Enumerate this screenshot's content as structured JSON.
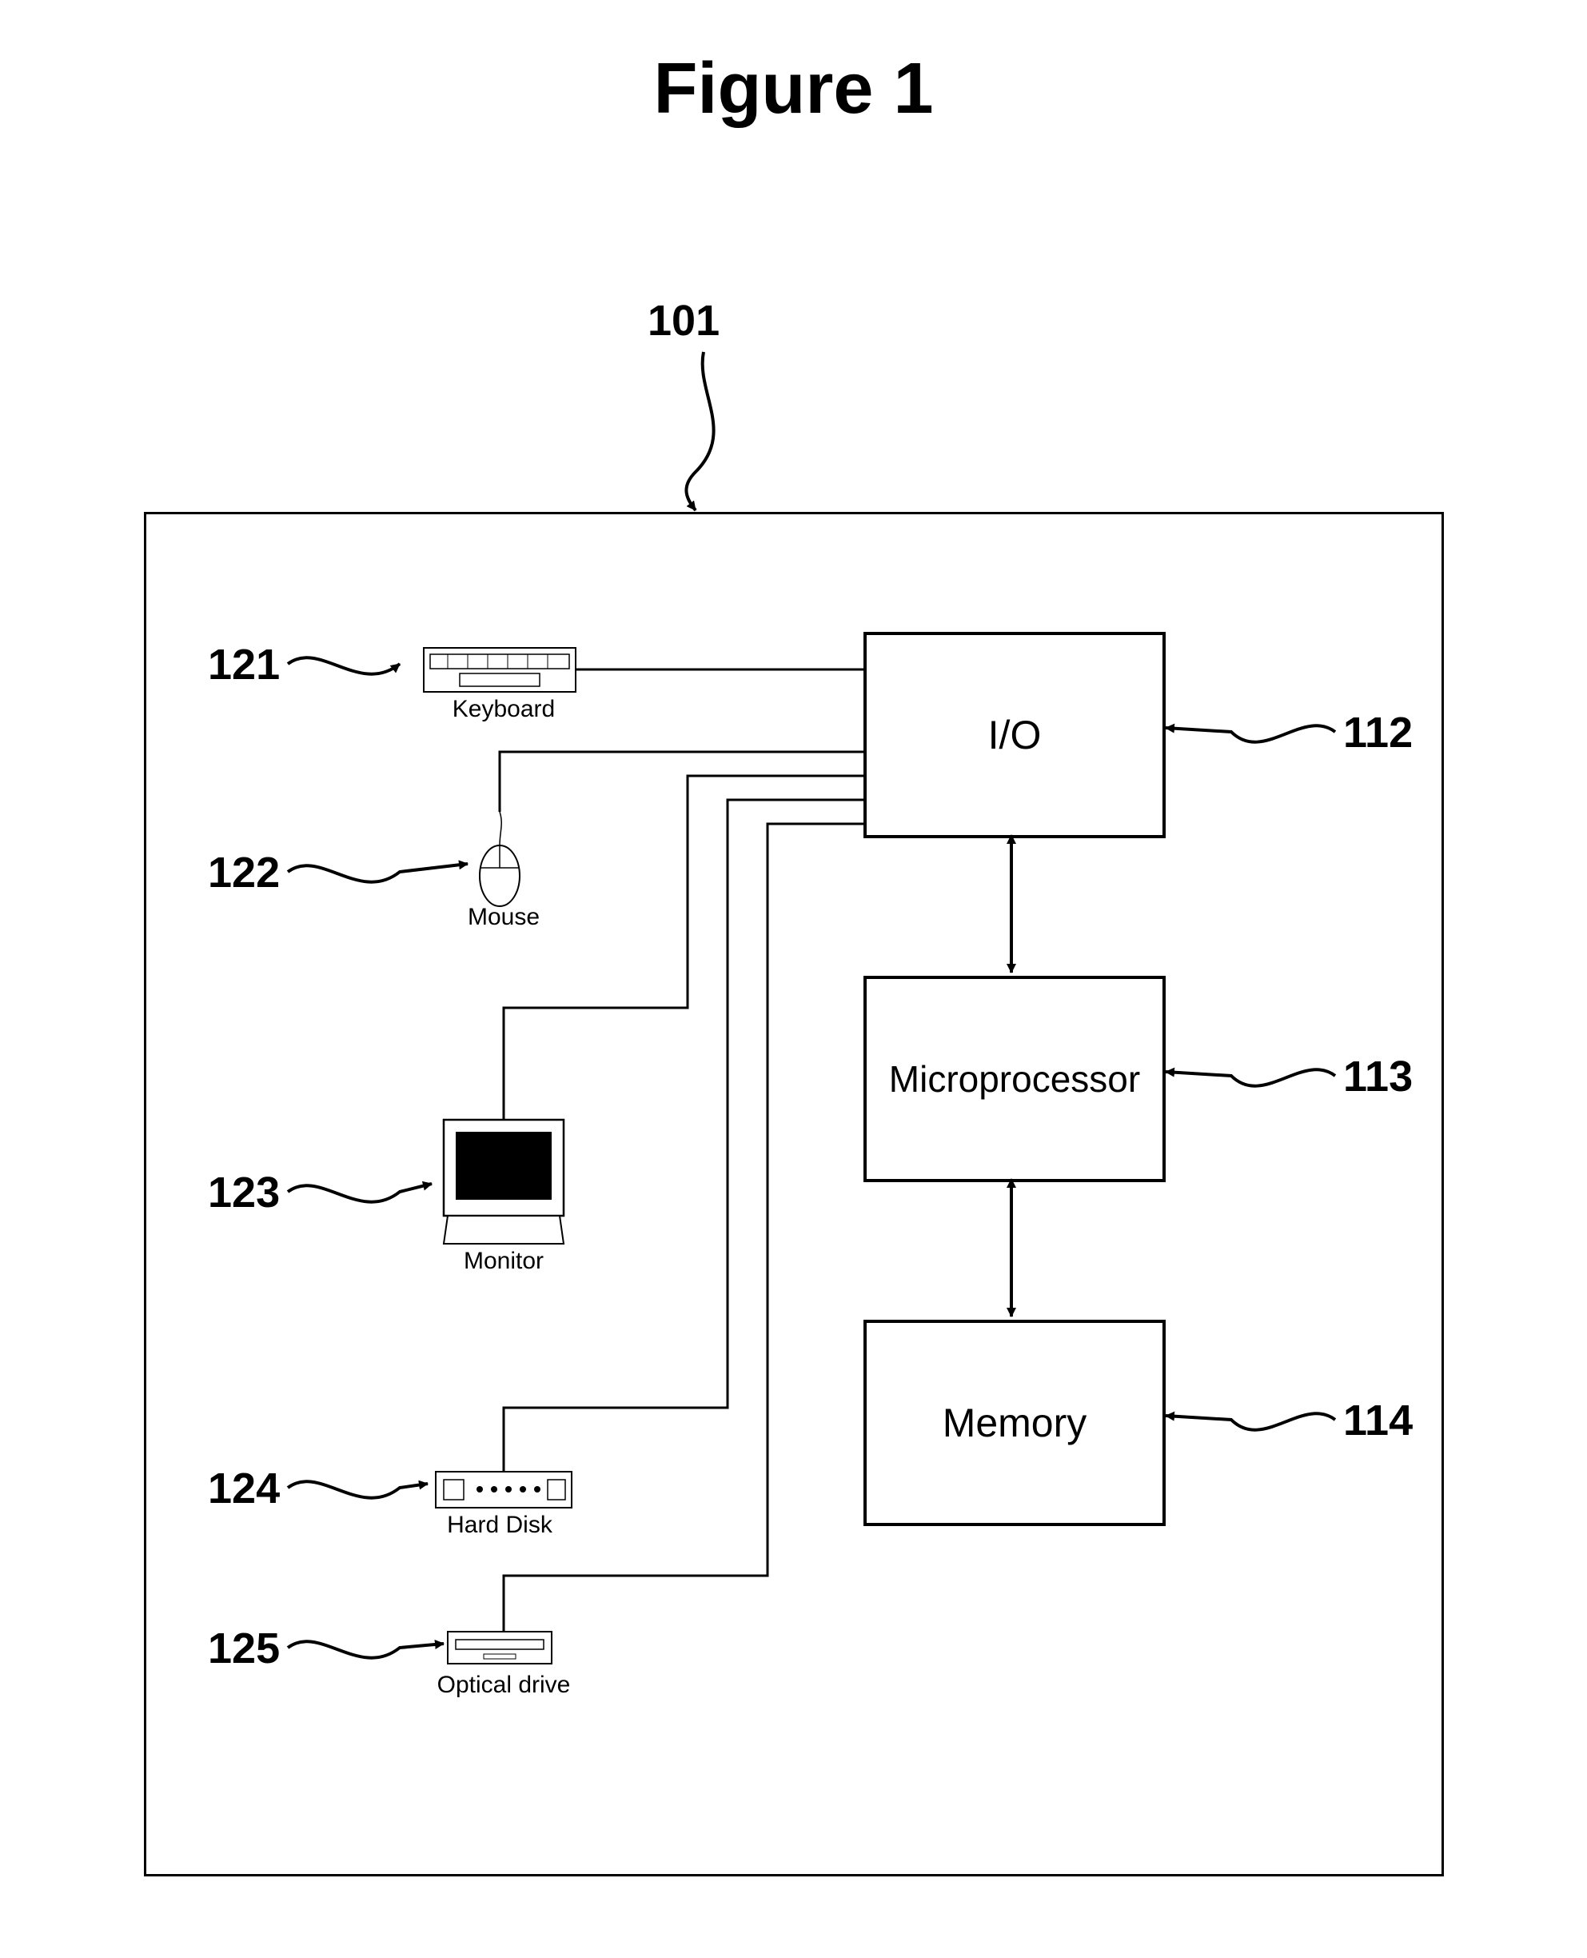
{
  "figure_title": "Figure 1",
  "refs": {
    "system": "101",
    "io": "112",
    "microprocessor": "113",
    "memory": "114",
    "keyboard": "121",
    "mouse": "122",
    "monitor": "123",
    "harddisk": "124",
    "optical": "125"
  },
  "blocks": {
    "io": "I/O",
    "microprocessor": "Microprocessor",
    "memory": "Memory"
  },
  "peripherals": {
    "keyboard": "Keyboard",
    "mouse": "Mouse",
    "monitor": "Monitor",
    "harddisk": "Hard Disk",
    "optical": "Optical drive"
  }
}
